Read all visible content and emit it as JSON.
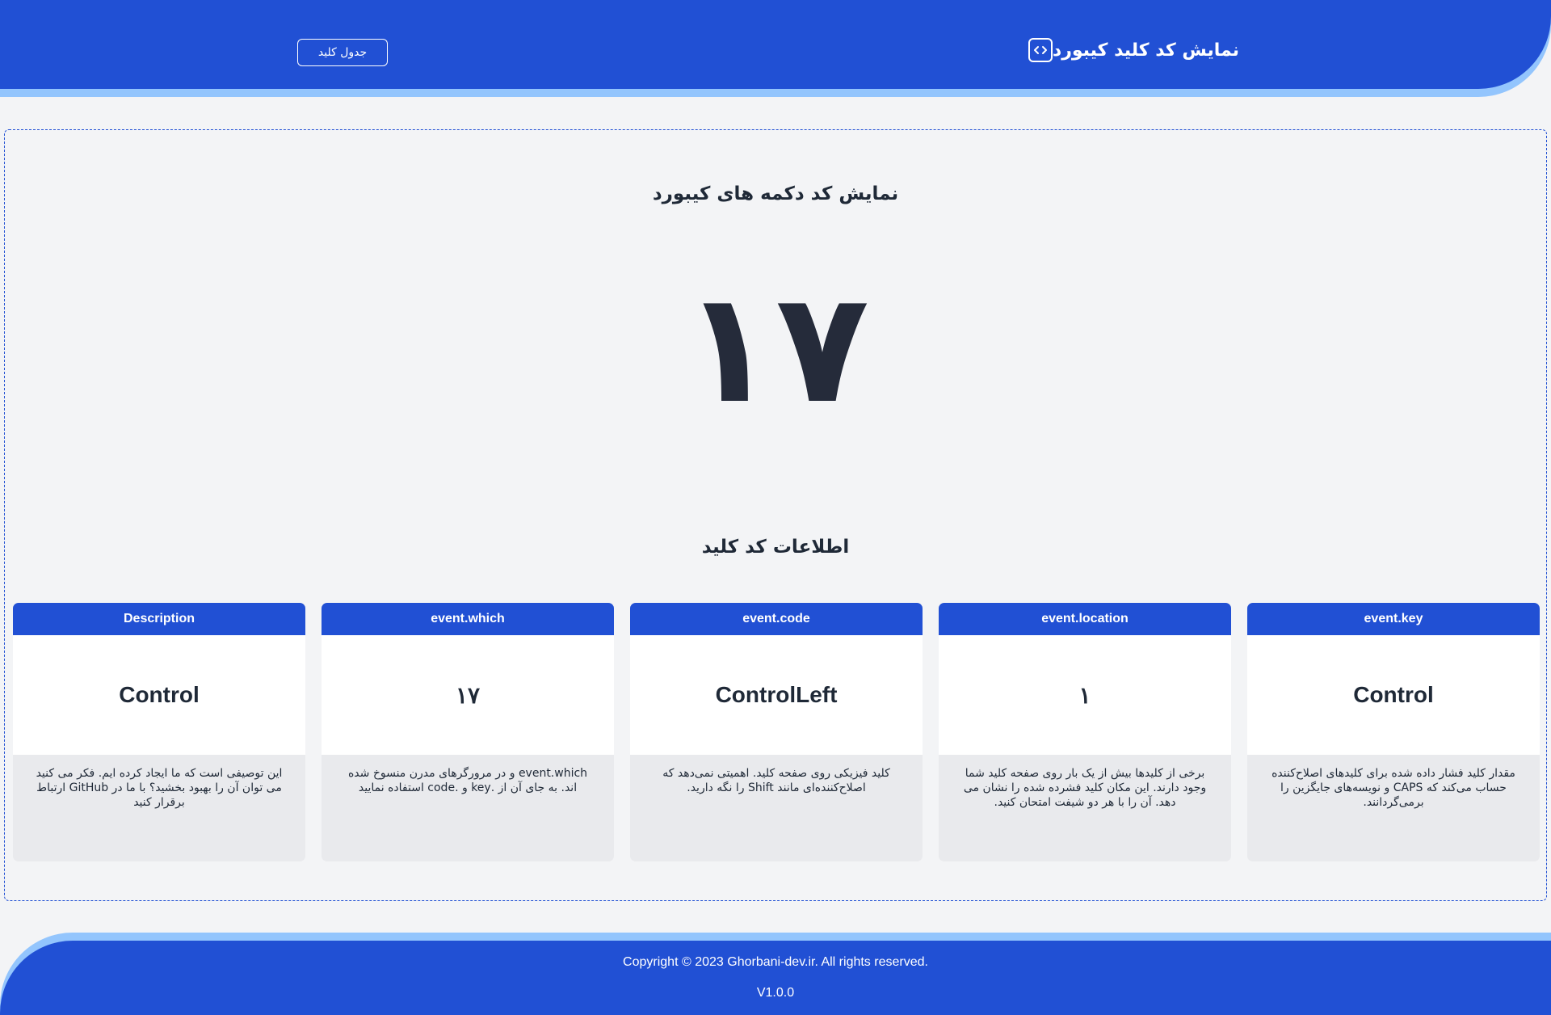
{
  "header": {
    "title": "نمایش کد کلید کیبورد",
    "icon": "code-icon",
    "table_button_label": "جدول کلید"
  },
  "main": {
    "title": "نمایش کد دکمه های کیبورد",
    "key_code": "۱۷",
    "info_title": "اطلاعات کد کلید"
  },
  "cards": [
    {
      "header": "event.key",
      "value": "Control",
      "description": "مقدار کلید فشار داده شده برای کلیدهای اصلاح‌کننده حساب می‌کند که CAPS و نویسه‌های جایگزین را برمی‌گردانند."
    },
    {
      "header": "event.location",
      "value": "۱",
      "description": "برخی از کلیدها بیش از یک بار روی صفحه کلید شما وجود دارند. این مکان کلید فشرده شده را نشان می دهد. آن را با هر دو شیفت امتحان کنید."
    },
    {
      "header": "event.code",
      "value": "ControlLeft",
      "description": "کلید فیزیکی روی صفحه کلید. اهمیتی نمی‌دهد که اصلاح‌کننده‌ای مانند Shift را نگه دارید."
    },
    {
      "header": "event.which",
      "value": "۱۷",
      "description": "event.which و در مرورگرهای مدرن منسوخ شده اند. به جای آن از .key و .code استفاده نمایید"
    },
    {
      "header": "Description",
      "value": "Control",
      "description": "این توصیفی است که ما ایجاد کرده ایم. فکر می کنید می توان آن را بهبود بخشید؟ با ما در GitHub ارتباط برقرار کنید"
    }
  ],
  "footer": {
    "copyright": "Copyright © 2023 Ghorbani-dev.ir. All rights reserved.",
    "version": "V1.0.0"
  },
  "colors": {
    "primary": "#2150d4",
    "accent": "#93c5fd",
    "background": "#f3f4f6",
    "text": "#1f2937"
  }
}
